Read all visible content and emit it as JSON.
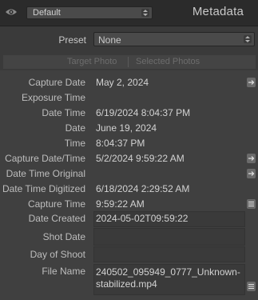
{
  "header": {
    "preset_select_value": "Default",
    "title": "Metadata"
  },
  "preset": {
    "label": "Preset",
    "value": "None"
  },
  "tabs": {
    "target": "Target Photo",
    "selected": "Selected Photos"
  },
  "fields": [
    {
      "label": "Capture Date",
      "value": "May 2, 2024",
      "button": "arrow"
    },
    {
      "label": "Exposure Time",
      "value": ""
    },
    {
      "label": "Date Time",
      "value": "6/19/2024 8:04:37 PM"
    },
    {
      "label": "Date",
      "value": "June 19, 2024"
    },
    {
      "label": "Time",
      "value": "8:04:37 PM"
    },
    {
      "label": "Capture Date/Time",
      "value": "5/2/2024 9:59:22 AM",
      "button": "arrow"
    },
    {
      "label": "Date Time Original",
      "value": "",
      "button": "arrow"
    },
    {
      "label": "Date Time Digitized",
      "value": "6/18/2024 2:29:52 AM"
    },
    {
      "label": "Capture Time",
      "value": "9:59:22 AM",
      "button": "list"
    },
    {
      "label": "Date Created",
      "value": "2024-05-02T09:59:22"
    },
    {
      "label": "Shot Date",
      "value": ""
    },
    {
      "label": "Day of Shoot",
      "value": ""
    },
    {
      "label": "File Name",
      "value_line1": "240502_095949_0777_Unknown-",
      "value_line2": "stabilized.mp4",
      "button": "list"
    }
  ],
  "icons": {
    "eye": "eye-icon",
    "spinner": "up-down-arrows-icon",
    "arrow": "right-arrow-icon",
    "list": "list-icon"
  }
}
